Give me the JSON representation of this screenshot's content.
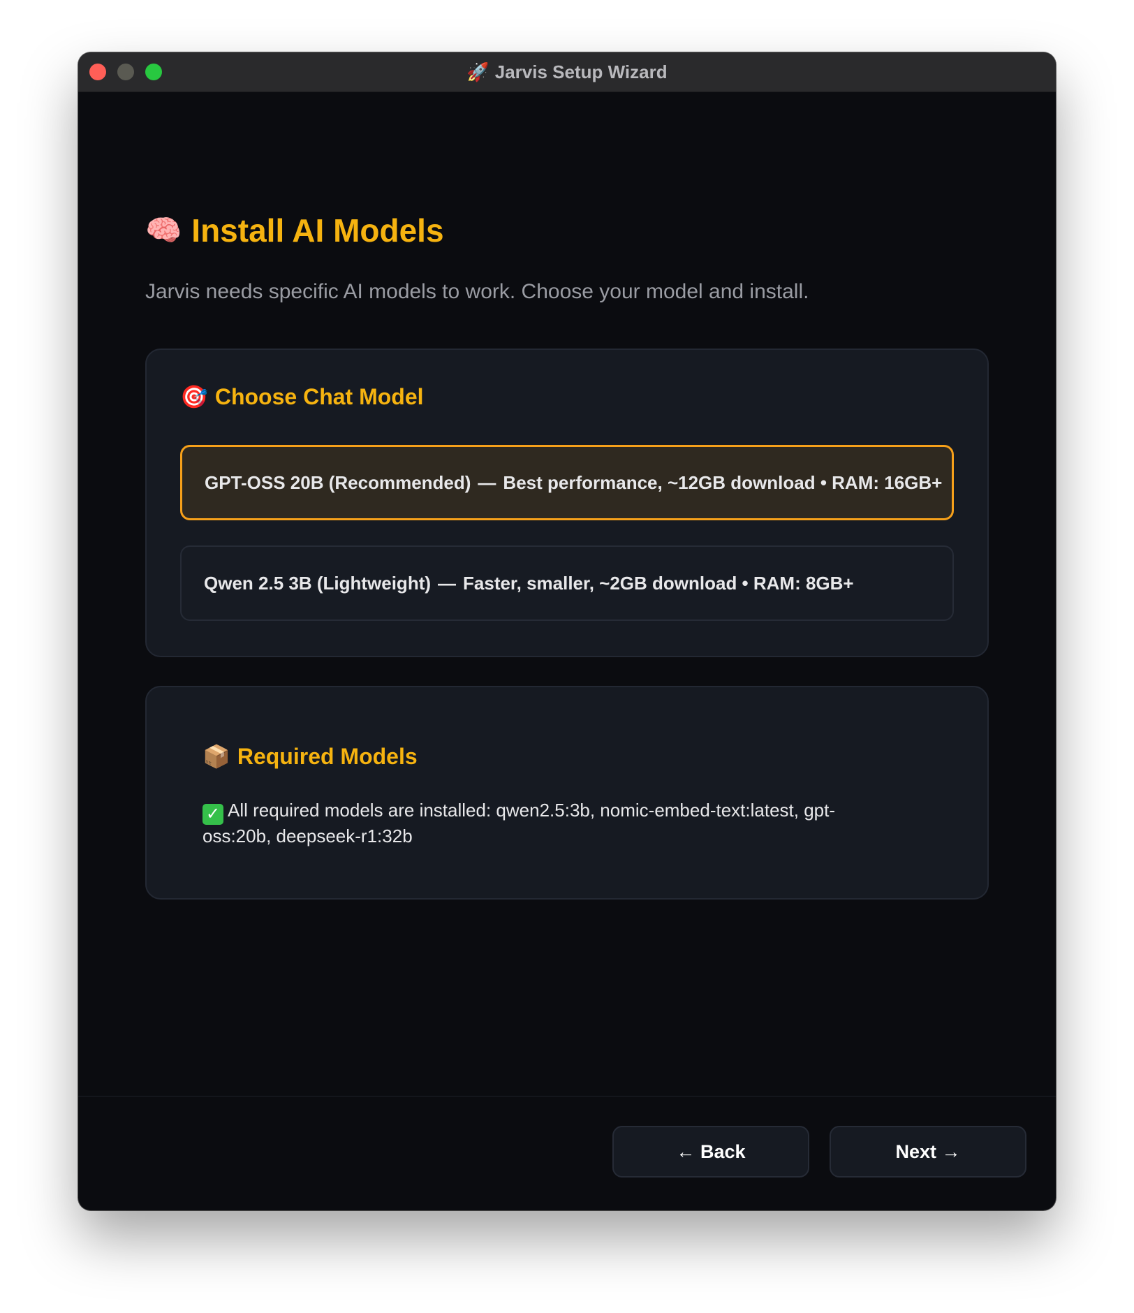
{
  "window": {
    "title": "Jarvis Setup Wizard",
    "title_icon": "rocket-icon"
  },
  "page": {
    "title": "Install AI Models",
    "title_icon": "brain-icon",
    "subtitle": "Jarvis needs specific AI models to work. Choose your model and install."
  },
  "chat_model": {
    "title": "Choose Chat Model",
    "icon": "target-icon",
    "options": [
      {
        "name": "GPT-OSS 20B (Recommended)",
        "separator": "—",
        "description": "Best performance, ~12GB download • RAM: 16GB+",
        "selected": true
      },
      {
        "name": "Qwen 2.5 3B (Lightweight)",
        "separator": "—",
        "description": "Faster, smaller, ~2GB download • RAM: 8GB+",
        "selected": false
      }
    ]
  },
  "required_models": {
    "title": "Required Models",
    "icon": "package-icon",
    "status": "All required models are installed: qwen2.5:3b, nomic-embed-text:latest, gpt-oss:20b, deepseek-r1:32b",
    "status_icon": "check-icon"
  },
  "footer": {
    "back_label": "← Back",
    "next_label": "Next →"
  },
  "colors": {
    "accent": "#f6b310",
    "selected_border": "#f6a01a",
    "background": "#0b0c10",
    "card": "#161a22",
    "success": "#35c04a"
  }
}
